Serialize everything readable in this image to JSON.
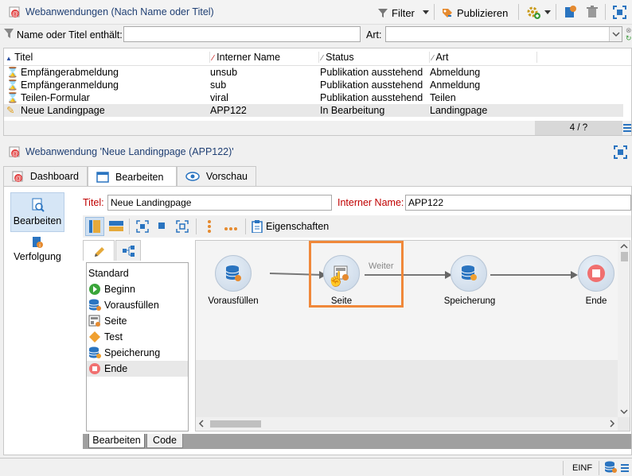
{
  "top_panel": {
    "title": "Webanwendungen (Nach Name oder Titel)",
    "filter_label": "Filter",
    "publish_label": "Publizieren"
  },
  "filter_bar": {
    "name_label": "Name oder Titel enthält:",
    "name_value": "",
    "type_label": "Art:",
    "type_value": ""
  },
  "list": {
    "columns": [
      "Titel",
      "Interner Name",
      "Status",
      "Art"
    ],
    "rows": [
      {
        "title": "Empfängerabmeldung",
        "internal": "unsub",
        "status": "Publikation ausstehend",
        "type": "Abmeldung",
        "icon": "hourglass-icon"
      },
      {
        "title": "Empfängeranmeldung",
        "internal": "sub",
        "status": "Publikation ausstehend",
        "type": "Anmeldung",
        "icon": "hourglass-icon"
      },
      {
        "title": "Teilen-Formular",
        "internal": "viral",
        "status": "Publikation ausstehend",
        "type": "Teilen",
        "icon": "hourglass-icon"
      },
      {
        "title": "Neue Landingpage",
        "internal": "APP122",
        "status": "In Bearbeitung",
        "type": "Landingpage",
        "icon": "pencil-icon"
      }
    ],
    "pagination": "4 / ?"
  },
  "detail": {
    "title": "Webanwendung 'Neue Landingpage (APP122)'",
    "tabs": [
      "Dashboard",
      "Bearbeiten",
      "Vorschau"
    ],
    "active_tab": "Bearbeiten",
    "side_nav": [
      "Bearbeiten",
      "Verfolgung"
    ],
    "fields": {
      "title_label": "Titel:",
      "title_value": "Neue Landingpage",
      "internal_label": "Interner Name:",
      "internal_value": "APP122"
    },
    "toolbar": {
      "properties_label": "Eigenschaften"
    },
    "palette": {
      "header": "Standard",
      "items": [
        "Beginn",
        "Vorausfüllen",
        "Seite",
        "Test",
        "Speicherung",
        "Ende"
      ]
    },
    "workflow": {
      "nodes": [
        "Vorausfüllen",
        "Seite",
        "Speicherung",
        "Ende"
      ],
      "transition_label": "Weiter"
    },
    "bottom_tabs": [
      "Bearbeiten",
      "Code"
    ]
  },
  "statusbar": {
    "input_mode": "EINF"
  },
  "colors": {
    "accent_blue": "#1f6fb5",
    "highlight_orange": "#f0883a",
    "required_red": "#c00000"
  }
}
